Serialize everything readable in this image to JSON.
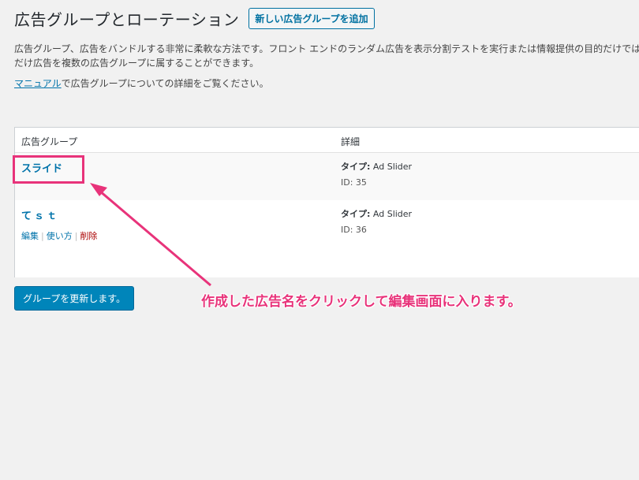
{
  "header": {
    "title": "広告グループとローテーション",
    "add_new_label": "新しい広告グループを追加"
  },
  "description": {
    "line1": "広告グループ、広告をバンドルする非常に柔軟な方法です。フロント エンドのランダム広告を表示分割テストを実行または情報提供の目的だけではなく",
    "line2": "だけ広告を複数の広告グループに属することができます。",
    "manual_link": "マニュアル",
    "manual_rest": "で広告グループについての詳細をご覧ください。"
  },
  "table": {
    "columns": [
      "広告グループ",
      "詳細"
    ],
    "rows": [
      {
        "name": "スライド",
        "type_label": "タイプ:",
        "type_value": "Ad Slider",
        "id_text": "ID: 35"
      },
      {
        "name": "てｓｔ",
        "type_label": "タイプ:",
        "type_value": "Ad Slider",
        "id_text": "ID: 36",
        "actions": {
          "edit": "編集",
          "usage": "使い方",
          "delete": "削除",
          "separator": "|"
        }
      }
    ]
  },
  "update_button_label": "グループを更新します。",
  "annotation": {
    "text": "作成した広告名をクリックして編集画面に入ります。",
    "color": "#e8337a"
  },
  "colors": {
    "link": "#0073aa",
    "primary_button": "#0085ba",
    "delete": "#a00"
  }
}
